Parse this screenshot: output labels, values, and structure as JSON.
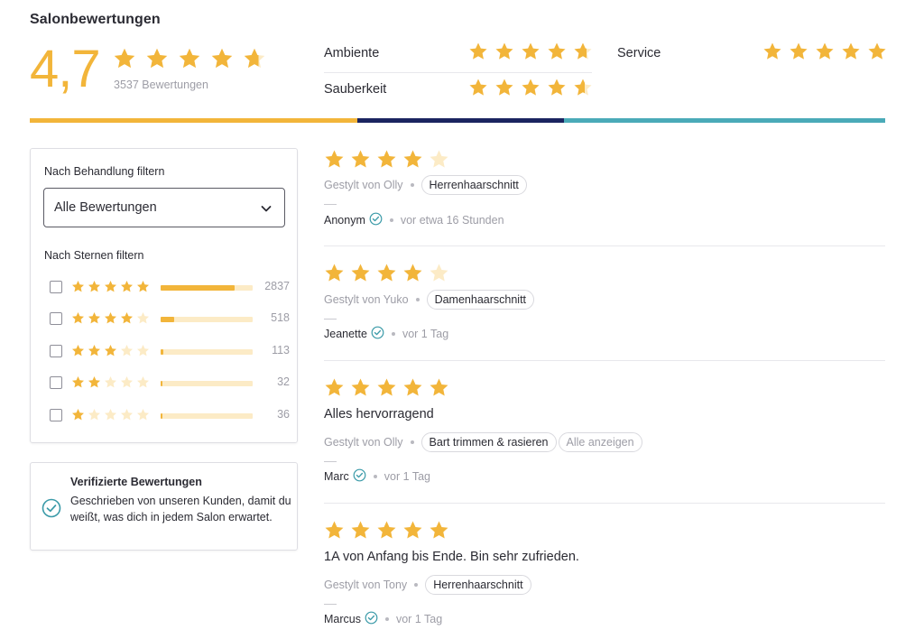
{
  "title": "Salonbewertungen",
  "summary": {
    "score": "4,7",
    "rating": 4.7,
    "count_text": "3537 Bewertungen"
  },
  "categories": [
    {
      "label": "Ambiente",
      "rating": 4.7
    },
    {
      "label": "Sauberkeit",
      "rating": 4.6
    },
    {
      "label": "Service",
      "rating": 5
    }
  ],
  "score_bar_colors": [
    "#f2b53a",
    "#1b2460",
    "#4aaab8"
  ],
  "colors": {
    "accent": "#f2b53a",
    "star_empty": "#fcebc6",
    "verified": "#3a9aa8",
    "text": "#2b2b33",
    "muted": "#9d9da6"
  },
  "filter": {
    "treatment_label": "Nach Behandlung filtern",
    "select_value": "Alle Bewertungen",
    "stars_label": "Nach Sternen filtern",
    "rows": [
      {
        "stars": 5,
        "count": "2837",
        "fraction": 0.8
      },
      {
        "stars": 4,
        "count": "518",
        "fraction": 0.146
      },
      {
        "stars": 3,
        "count": "113",
        "fraction": 0.032
      },
      {
        "stars": 2,
        "count": "32",
        "fraction": 0.009
      },
      {
        "stars": 1,
        "count": "36",
        "fraction": 0.01
      }
    ]
  },
  "verified_box": {
    "title": "Verifizierte Bewertungen",
    "text": "Geschrieben von unseren Kunden, damit du weißt, was dich in jedem Salon erwartet."
  },
  "reviews": [
    {
      "stars": 4,
      "text": "",
      "styled_by": "Gestylt von Olly",
      "service": "Herrenhaarschnitt",
      "show_all": "",
      "author": "Anonym",
      "time": "vor etwa 16 Stunden"
    },
    {
      "stars": 4,
      "text": "",
      "styled_by": "Gestylt von Yuko",
      "service": "Damenhaarschnitt",
      "show_all": "",
      "author": "Jeanette",
      "time": "vor 1 Tag"
    },
    {
      "stars": 5,
      "text": "Alles hervorragend",
      "styled_by": "Gestylt von Olly",
      "service": "Bart trimmen & rasieren",
      "show_all": "Alle anzeigen",
      "author": "Marc",
      "time": "vor 1 Tag"
    },
    {
      "stars": 5,
      "text": "1A von Anfang bis Ende. Bin sehr zufrieden.",
      "styled_by": "Gestylt von Tony",
      "service": "Herrenhaarschnitt",
      "show_all": "",
      "author": "Marcus",
      "time": "vor 1 Tag"
    }
  ]
}
